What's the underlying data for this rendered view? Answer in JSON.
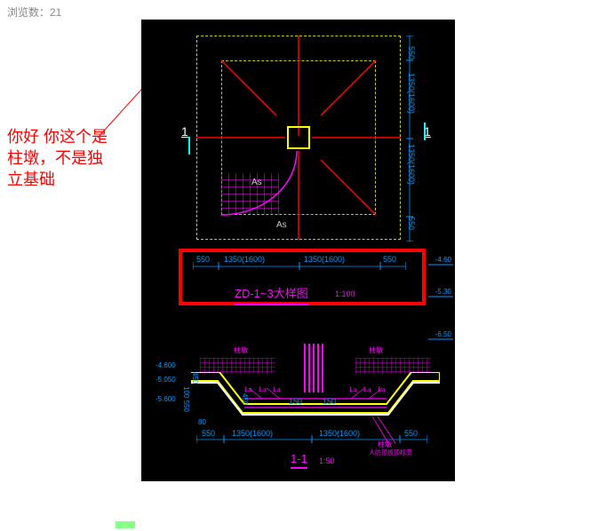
{
  "meta": {
    "view_count_label": "浏览数：21"
  },
  "annotation": {
    "line1": "你好 你这个是",
    "line2": "柱墩，不是独",
    "line3": "立基础"
  },
  "plan": {
    "dims_h": [
      "550",
      "1350(1600)",
      "1350(1600)",
      "550"
    ],
    "dims_v": [
      "550",
      "1350(1600)",
      "1350(1600)",
      "550"
    ],
    "as_label_1": "As",
    "as_label_2": "As",
    "section_mark_left": "1",
    "section_mark_right": "1"
  },
  "title_block": {
    "main": "ZD-1~3大样图",
    "scale": "1:100"
  },
  "right_levels": {
    "l1": "-4.60",
    "l2": "-5.30",
    "l3": "-6.50"
  },
  "section": {
    "elev_1": "-4.600",
    "elev_2": "-5.050",
    "elev_3": "-5.600",
    "dim_80": "80",
    "dim_450": "450",
    "dim_100550": "100 550",
    "dim_450b": "450",
    "dim_150a": "150",
    "dim_150b": "150",
    "la_1": "La",
    "la_2": "La",
    "la_3": "La",
    "la_4": "La",
    "la_5": "La",
    "la_6": "La",
    "dims_bottom": [
      "550",
      "1350(1600)",
      "1350(1600)",
      "550"
    ],
    "title": "1-1",
    "scale": "1:50",
    "hatch_label_1": "柱墩",
    "hatch_label_2": "柱墩",
    "note": "人防顶板顶标高"
  }
}
